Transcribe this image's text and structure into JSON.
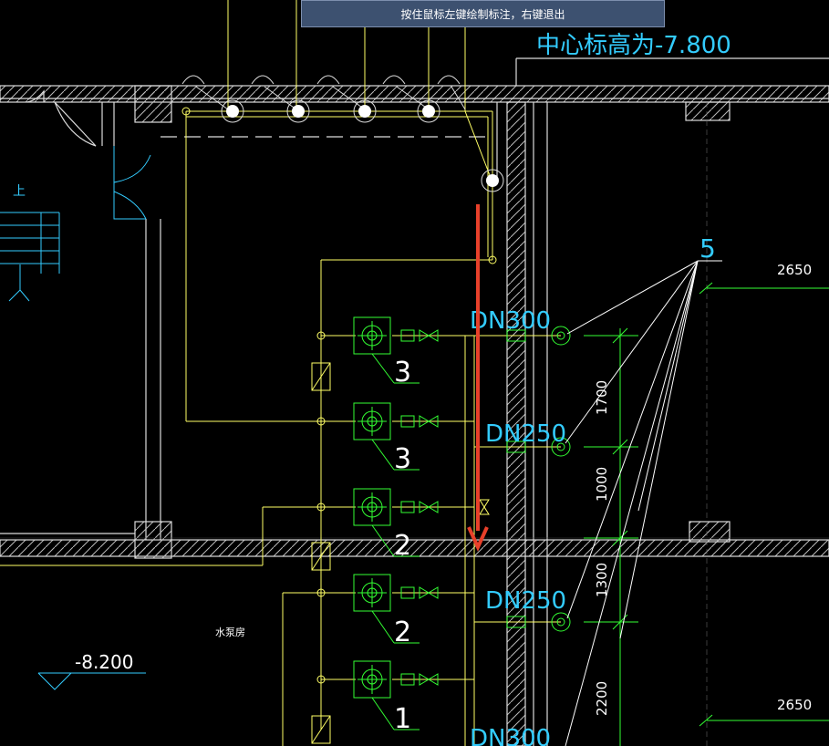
{
  "tooltip": {
    "text": "按住鼠标左键绘制标注，右键退出"
  },
  "labels": {
    "center_elev": "中心标高为-7.800",
    "dn300_top": "DN300",
    "dn250_1": "DN250",
    "dn250_2": "DN250",
    "dn300_bottom": "DN300",
    "leader_num": "5",
    "dim_2650_top": "2650",
    "dim_2650_bottom": "2650",
    "dim_1700": "1700",
    "dim_1000": "1000",
    "dim_1300": "1300",
    "dim_2200": "2200",
    "pump_3a": "3",
    "pump_3b": "3",
    "pump_2a": "2",
    "pump_2b": "2",
    "pump_1": "1",
    "room_name": "水泵房",
    "elev_8200": "-8.200",
    "stair_up": "上"
  },
  "colors": {
    "background": "#000000",
    "wall": "#ffffff",
    "pipe": "#ffff66",
    "pump": "#33ff33",
    "cyan_text": "#33ccff",
    "dimension": "#33ff33",
    "arrow": "#e8402a"
  }
}
